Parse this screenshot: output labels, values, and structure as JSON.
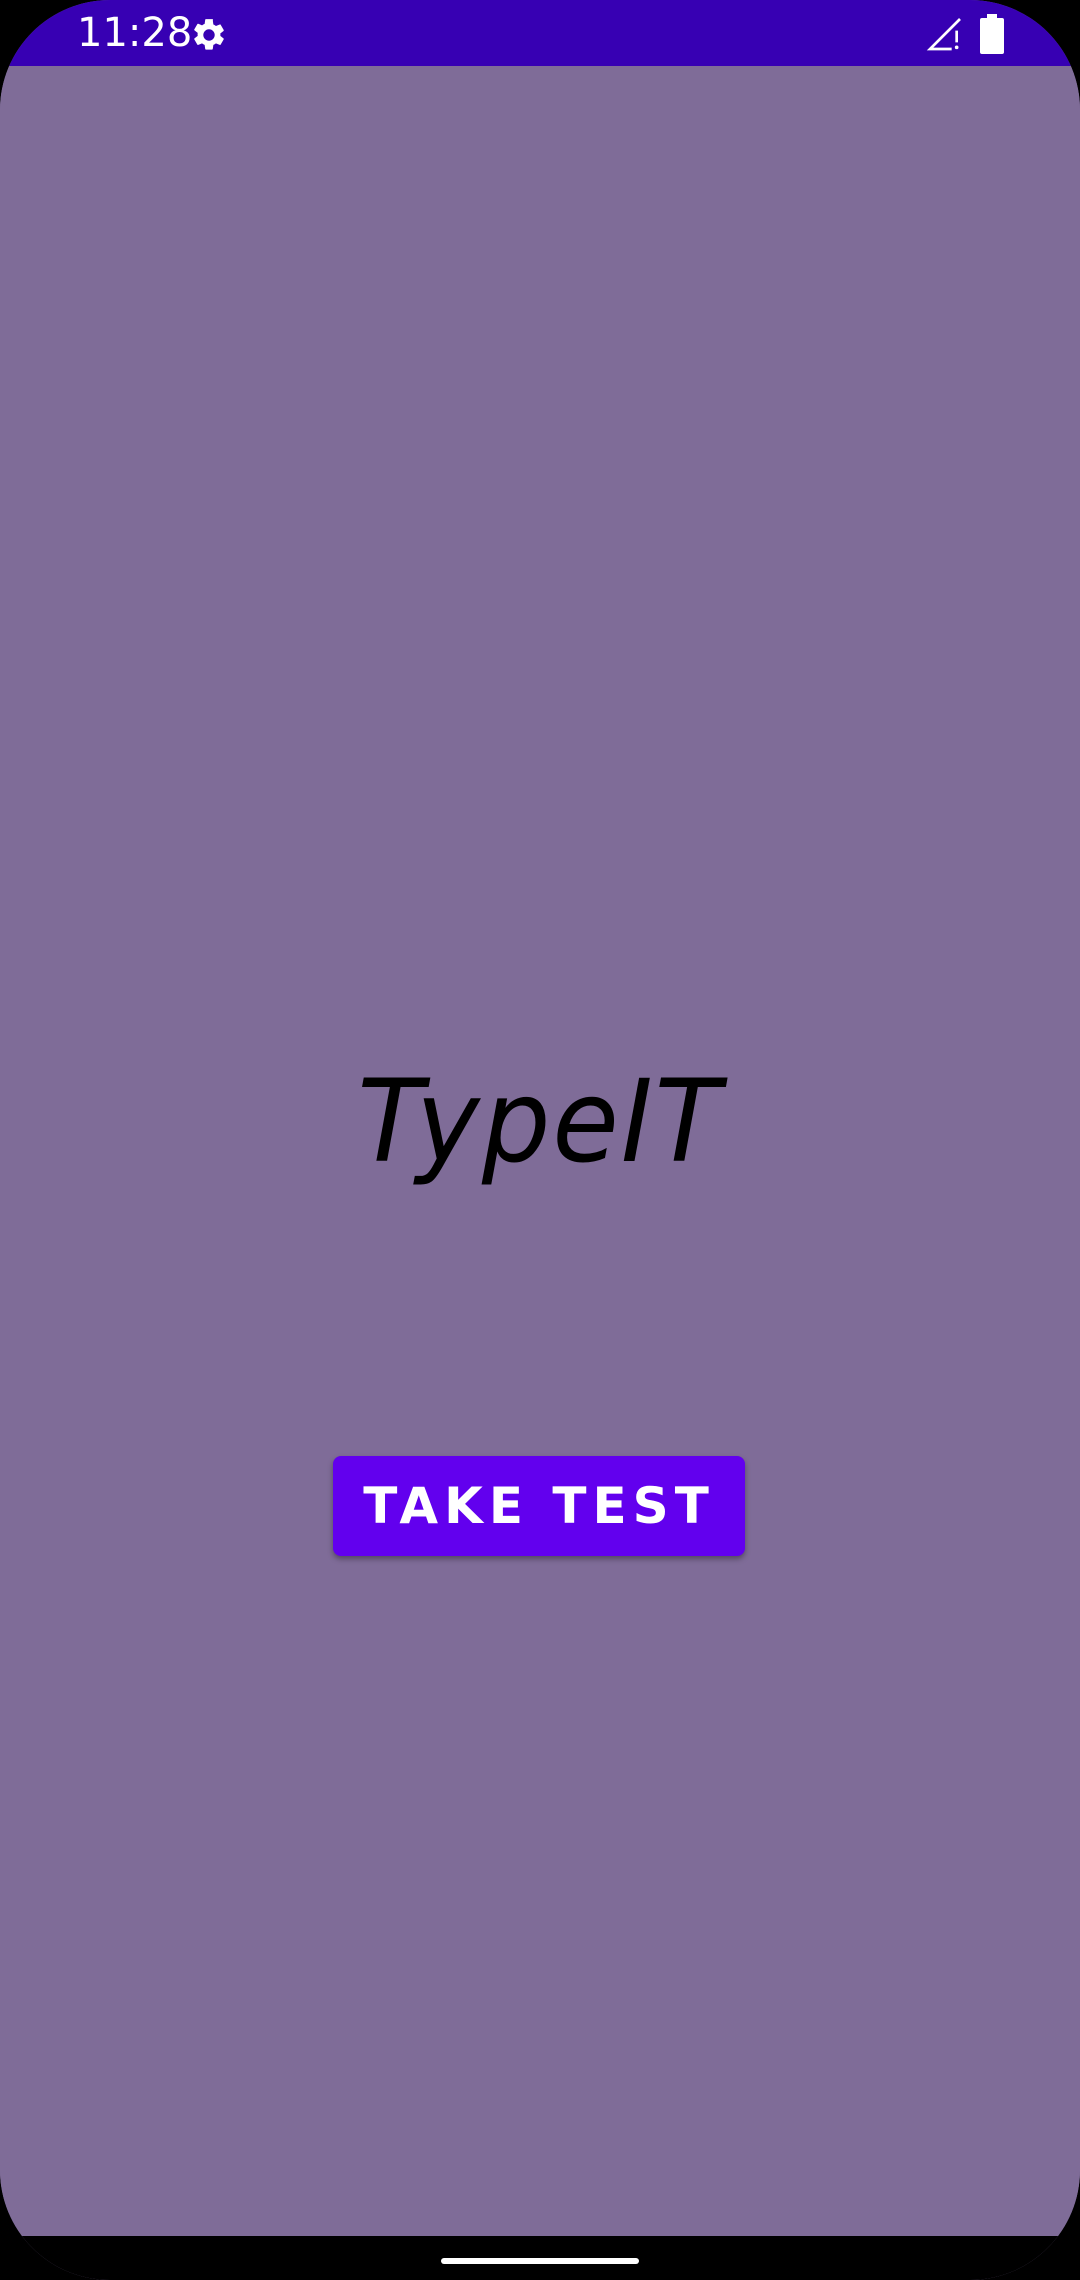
{
  "status_bar": {
    "time": "11:28",
    "background": "#3700b3",
    "icons": [
      "gear-icon",
      "signal-icon",
      "battery-icon"
    ]
  },
  "main": {
    "background": "#7f6c98",
    "app_title": "TypeIT",
    "take_test_label": "TAKE TEST",
    "button_color": "#6200ee"
  },
  "navigation": {
    "handle": "home-handle"
  }
}
